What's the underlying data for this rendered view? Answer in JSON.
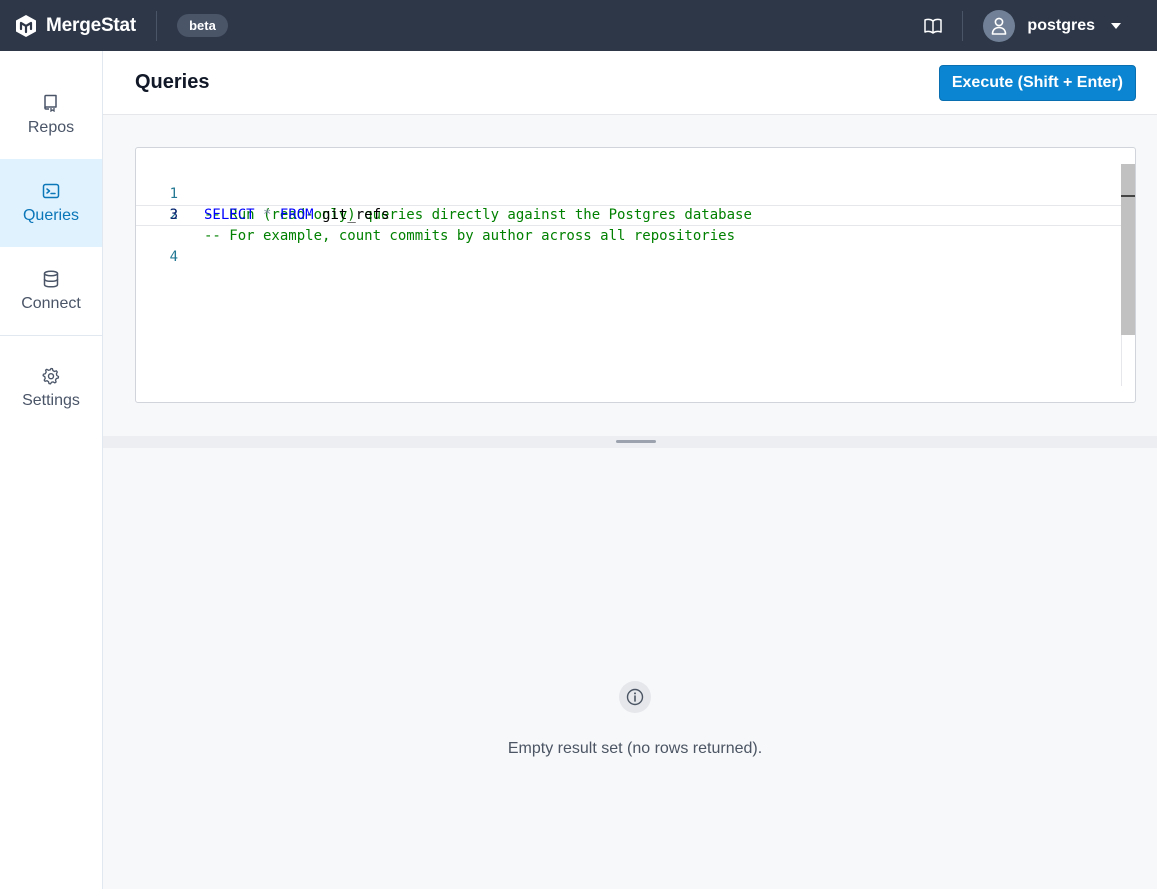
{
  "header": {
    "brand_name": "MergeStat",
    "badge": "beta",
    "docs_icon": "book-icon",
    "user": {
      "name": "postgres",
      "icon": "user-icon",
      "caret_icon": "caret-down-icon"
    }
  },
  "sidebar": {
    "items": [
      {
        "label": "Repos",
        "icon": "repo-icon",
        "active": false
      },
      {
        "label": "Queries",
        "icon": "terminal-icon",
        "active": true
      },
      {
        "label": "Connect",
        "icon": "database-icon",
        "active": false
      },
      {
        "label": "Settings",
        "icon": "gear-icon",
        "active": false
      }
    ]
  },
  "page": {
    "title": "Queries",
    "execute_label": "Execute (Shift + Enter)"
  },
  "editor": {
    "lines": [
      {
        "number": "1",
        "text": "-- Run (read-only) queries directly against the Postgres database"
      },
      {
        "number": "2",
        "text": "-- For example, count commits by author across all repositories"
      },
      {
        "number": "3",
        "keyword1": "SELECT",
        "op": "*",
        "keyword2": "FROM",
        "ident": "git_refs"
      },
      {
        "number": "4",
        "text": ""
      }
    ],
    "current_line": 3
  },
  "results": {
    "icon": "info-icon",
    "empty_message": "Empty result set (no rows returned)."
  },
  "colors": {
    "topbar": "#2d3748",
    "accent": "#0b84d1",
    "active_nav_bg": "#e0f2fe",
    "active_nav_text": "#0b76b8",
    "comment": "#008000",
    "keyword": "#0000ff"
  }
}
